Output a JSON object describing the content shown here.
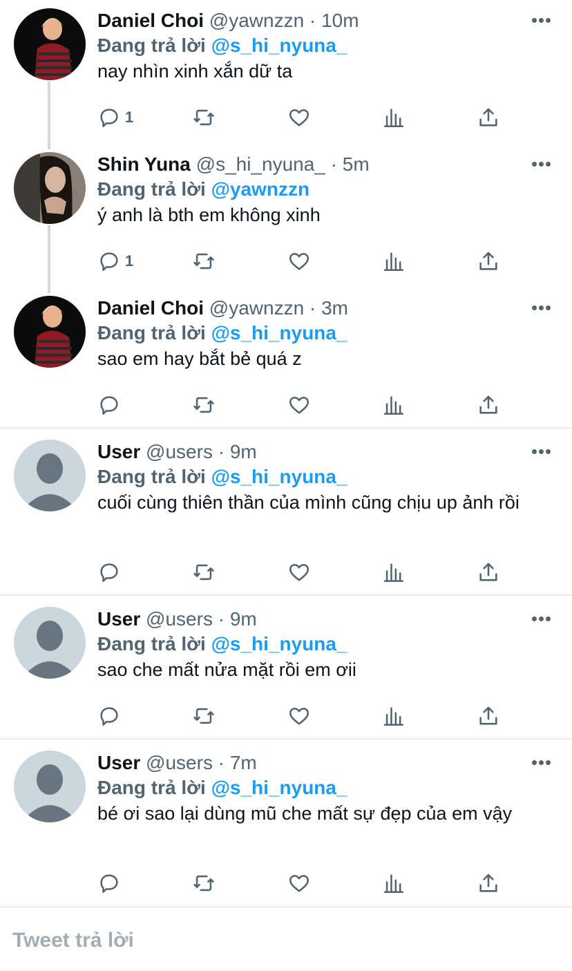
{
  "replying_label": "Đang trả lời",
  "colors": {
    "accent": "#1d9bf0",
    "muted": "#536471",
    "thread": "#cfd9de"
  },
  "tweets": [
    {
      "name": "Daniel Choi",
      "handle": "@yawnzzn",
      "dot": "·",
      "time": "10m",
      "reply_to": "@s_hi_nyuna_",
      "text": "nay nhìn xinh xắn dữ ta",
      "reply_count": "1",
      "avatar": "daniel-avatar"
    },
    {
      "name": "Shin Yuna",
      "handle": "@s_hi_nyuna_",
      "dot": "·",
      "time": "5m",
      "reply_to": "@yawnzzn",
      "text": "ý anh là bth em không xinh",
      "reply_count": "1",
      "avatar": "yuna-avatar"
    },
    {
      "name": "Daniel Choi",
      "handle": "@yawnzzn",
      "dot": "·",
      "time": "3m",
      "reply_to": "@s_hi_nyuna_",
      "text": "sao em hay bắt bẻ quá z",
      "reply_count": "",
      "avatar": "daniel-avatar"
    },
    {
      "name": "User",
      "handle": "@users",
      "dot": "·",
      "time": "9m",
      "reply_to": "@s_hi_nyuna_",
      "text": "cuối cùng thiên thần của mình cũng chịu up ảnh rồi",
      "reply_count": "",
      "avatar": "default-avatar"
    },
    {
      "name": "User",
      "handle": "@users",
      "dot": "·",
      "time": "9m",
      "reply_to": "@s_hi_nyuna_",
      "text": "sao che mất nửa mặt rồi em ơii",
      "reply_count": "",
      "avatar": "default-avatar"
    },
    {
      "name": "User",
      "handle": "@users",
      "dot": "·",
      "time": "7m",
      "reply_to": "@s_hi_nyuna_",
      "text": "bé ơi sao lại dùng mũ che mất sự đẹp của em vậy",
      "reply_count": "",
      "avatar": "default-avatar"
    }
  ],
  "reply_placeholder": "Tweet trả lời"
}
